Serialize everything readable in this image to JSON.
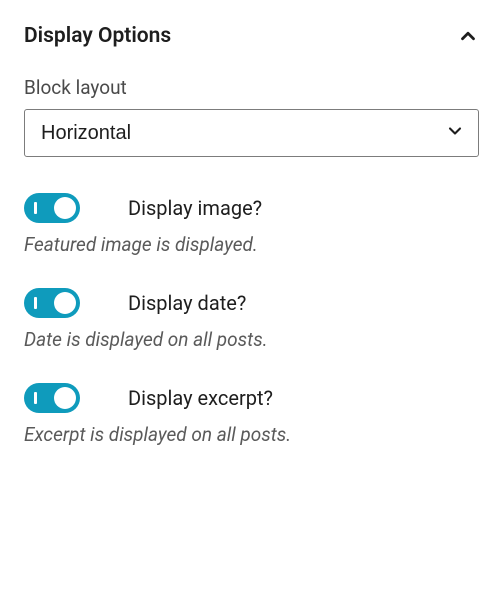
{
  "panel": {
    "title": "Display Options"
  },
  "blockLayout": {
    "label": "Block layout",
    "value": "Horizontal"
  },
  "toggles": [
    {
      "label": "Display image?",
      "help": "Featured image is displayed."
    },
    {
      "label": "Display date?",
      "help": "Date is displayed on all posts."
    },
    {
      "label": "Display excerpt?",
      "help": "Excerpt is displayed on all posts."
    }
  ]
}
